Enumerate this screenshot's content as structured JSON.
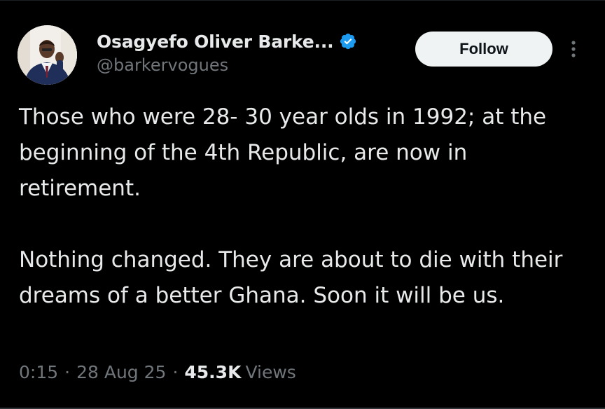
{
  "author": {
    "display_name": "Osagyefo Oliver Barke...",
    "handle": "@barkervogues",
    "verified": true
  },
  "follow_button": {
    "label": "Follow"
  },
  "tweet": {
    "paragraphs": [
      "Those who were 28- 30 year olds in 1992; at the beginning of the 4th Republic, are now in retirement.",
      "Nothing changed. They are about to die with their dreams of a better Ghana. Soon it will be us."
    ],
    "time": "0:15",
    "date": "28 Aug 25",
    "views_count": "45.3K",
    "views_label": "Views"
  },
  "icons": {
    "verified": "verified-badge-icon",
    "more": "more-options-icon"
  },
  "colors": {
    "background": "#000000",
    "text": "#e7e9ea",
    "secondary_text": "#71767b",
    "verified_blue": "#1d9bf0",
    "follow_bg": "#eff3f4",
    "follow_text": "#0f1419"
  }
}
